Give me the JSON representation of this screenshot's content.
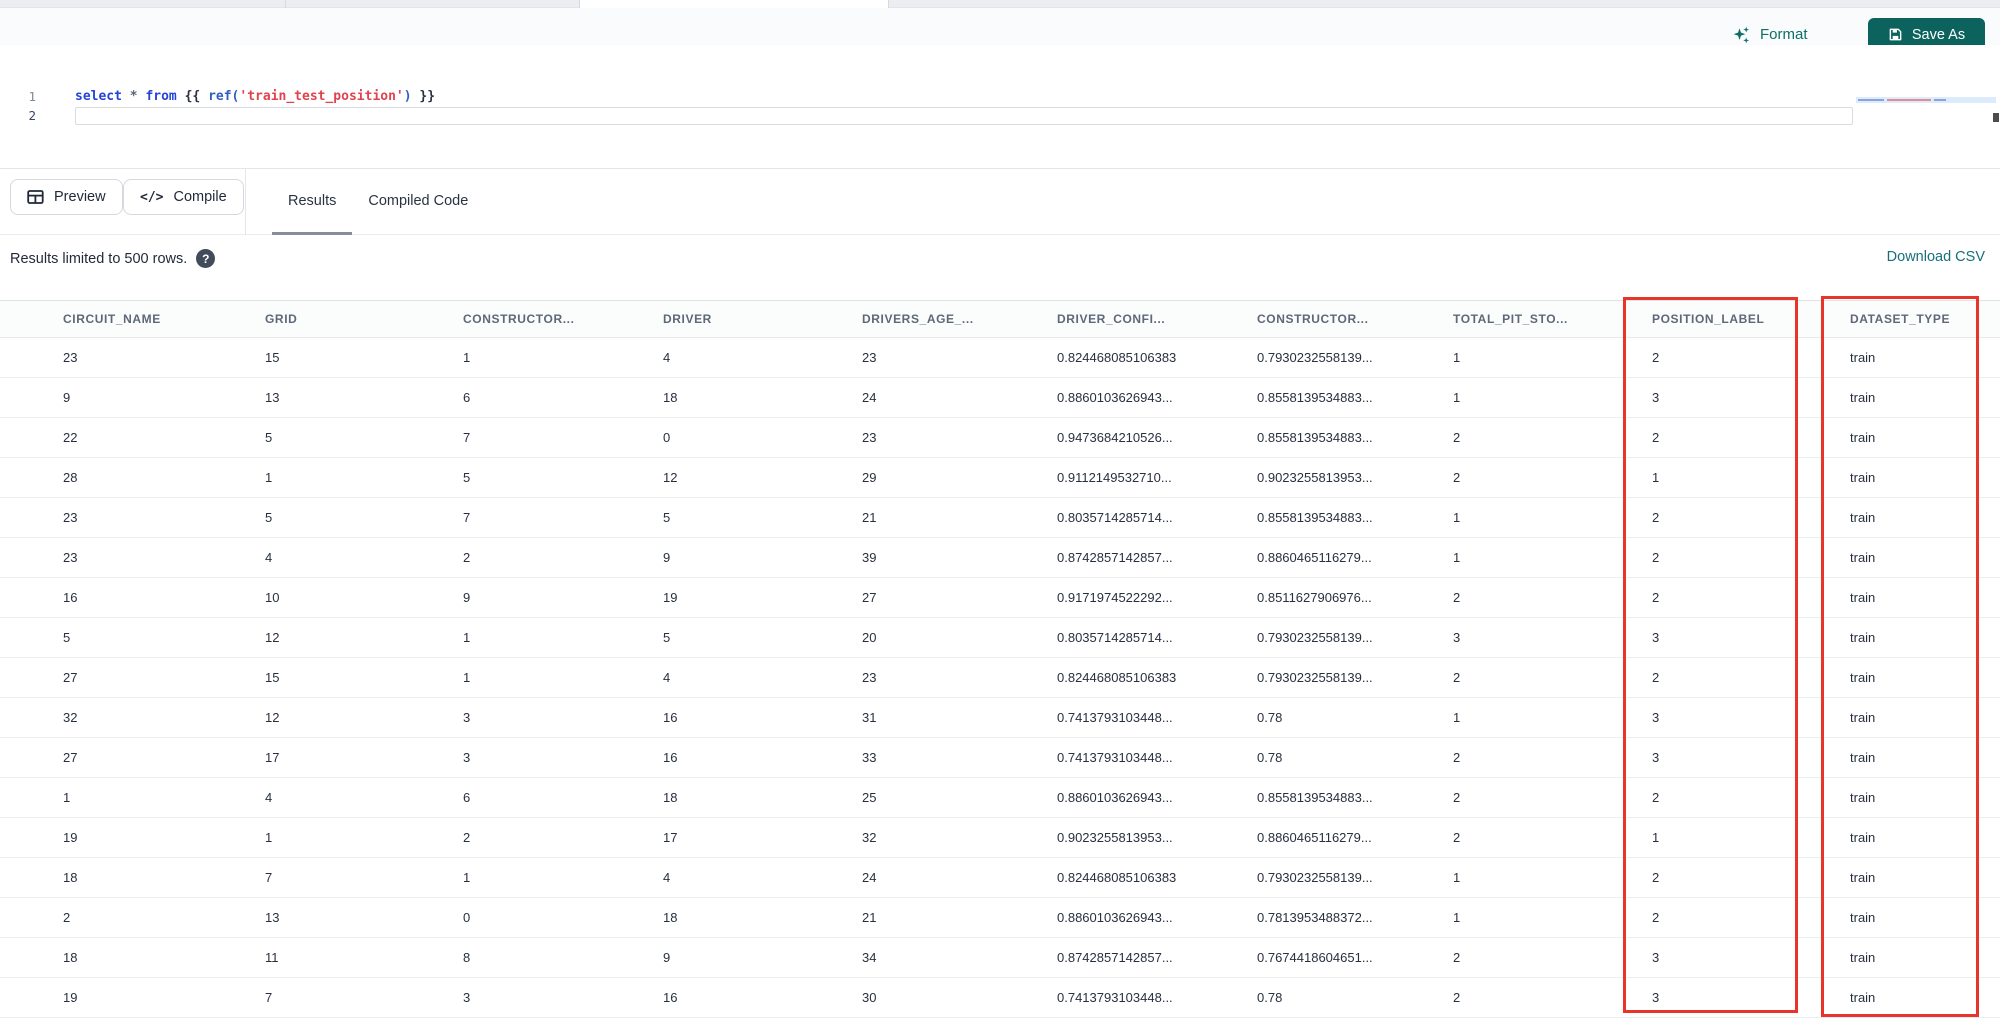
{
  "toolbar": {
    "format_label": "Format",
    "save_as_label": "Save As"
  },
  "editor": {
    "line_numbers": [
      "1",
      "2"
    ],
    "code_tokens": [
      {
        "text": "select",
        "style": "keyword"
      },
      {
        "text": " ",
        "style": "operator"
      },
      {
        "text": "*",
        "style": "operator"
      },
      {
        "text": " ",
        "style": "operator"
      },
      {
        "text": "from",
        "style": "keyword"
      },
      {
        "text": " {{ ",
        "style": "brace"
      },
      {
        "text": "ref(",
        "style": "function"
      },
      {
        "text": "'train_test_position'",
        "style": "string"
      },
      {
        "text": ")",
        "style": "function"
      },
      {
        "text": " }}",
        "style": "brace"
      }
    ]
  },
  "actions": {
    "preview_label": "Preview",
    "compile_label": "Compile",
    "compile_glyph": "</>"
  },
  "tabs": [
    {
      "label": "Results",
      "active": true
    },
    {
      "label": "Compiled Code",
      "active": false
    }
  ],
  "results": {
    "limit_note": "Results limited to 500 rows.",
    "help_glyph": "?",
    "download_csv_label": "Download CSV"
  },
  "table": {
    "columns": [
      "CIRCUIT_NAME",
      "GRID",
      "CONSTRUCTOR...",
      "DRIVER",
      "DRIVERS_AGE_...",
      "DRIVER_CONFI...",
      "CONSTRUCTOR...",
      "TOTAL_PIT_STO...",
      "POSITION_LABEL",
      "DATASET_TYPE"
    ],
    "rows": [
      [
        "23",
        "15",
        "1",
        "4",
        "23",
        "0.824468085106383",
        "0.7930232558139...",
        "1",
        "2",
        "train"
      ],
      [
        "9",
        "13",
        "6",
        "18",
        "24",
        "0.8860103626943...",
        "0.8558139534883...",
        "1",
        "3",
        "train"
      ],
      [
        "22",
        "5",
        "7",
        "0",
        "23",
        "0.9473684210526...",
        "0.8558139534883...",
        "2",
        "2",
        "train"
      ],
      [
        "28",
        "1",
        "5",
        "12",
        "29",
        "0.9112149532710...",
        "0.9023255813953...",
        "2",
        "1",
        "train"
      ],
      [
        "23",
        "5",
        "7",
        "5",
        "21",
        "0.8035714285714...",
        "0.8558139534883...",
        "1",
        "2",
        "train"
      ],
      [
        "23",
        "4",
        "2",
        "9",
        "39",
        "0.8742857142857...",
        "0.8860465116279...",
        "1",
        "2",
        "train"
      ],
      [
        "16",
        "10",
        "9",
        "19",
        "27",
        "0.9171974522292...",
        "0.8511627906976...",
        "2",
        "2",
        "train"
      ],
      [
        "5",
        "12",
        "1",
        "5",
        "20",
        "0.8035714285714...",
        "0.7930232558139...",
        "3",
        "3",
        "train"
      ],
      [
        "27",
        "15",
        "1",
        "4",
        "23",
        "0.824468085106383",
        "0.7930232558139...",
        "2",
        "2",
        "train"
      ],
      [
        "32",
        "12",
        "3",
        "16",
        "31",
        "0.7413793103448...",
        "0.78",
        "1",
        "3",
        "train"
      ],
      [
        "27",
        "17",
        "3",
        "16",
        "33",
        "0.7413793103448...",
        "0.78",
        "2",
        "3",
        "train"
      ],
      [
        "1",
        "4",
        "6",
        "18",
        "25",
        "0.8860103626943...",
        "0.8558139534883...",
        "2",
        "2",
        "train"
      ],
      [
        "19",
        "1",
        "2",
        "17",
        "32",
        "0.9023255813953...",
        "0.8860465116279...",
        "2",
        "1",
        "train"
      ],
      [
        "18",
        "7",
        "1",
        "4",
        "24",
        "0.824468085106383",
        "0.7930232558139...",
        "1",
        "2",
        "train"
      ],
      [
        "2",
        "13",
        "0",
        "18",
        "21",
        "0.8860103626943...",
        "0.7813953488372...",
        "1",
        "2",
        "train"
      ],
      [
        "18",
        "11",
        "8",
        "9",
        "34",
        "0.8742857142857...",
        "0.7674418604651...",
        "2",
        "3",
        "train"
      ],
      [
        "19",
        "7",
        "3",
        "16",
        "30",
        "0.7413793103448...",
        "0.78",
        "2",
        "3",
        "train"
      ]
    ],
    "highlighted_columns": [
      "POSITION_LABEL",
      "DATASET_TYPE"
    ],
    "highlight_color": "#e8352b"
  },
  "colors": {
    "primary_button": "#0c635e",
    "accent_teal": "#0d6f68",
    "link_teal": "#17707c",
    "highlight_red": "#e8352b"
  }
}
